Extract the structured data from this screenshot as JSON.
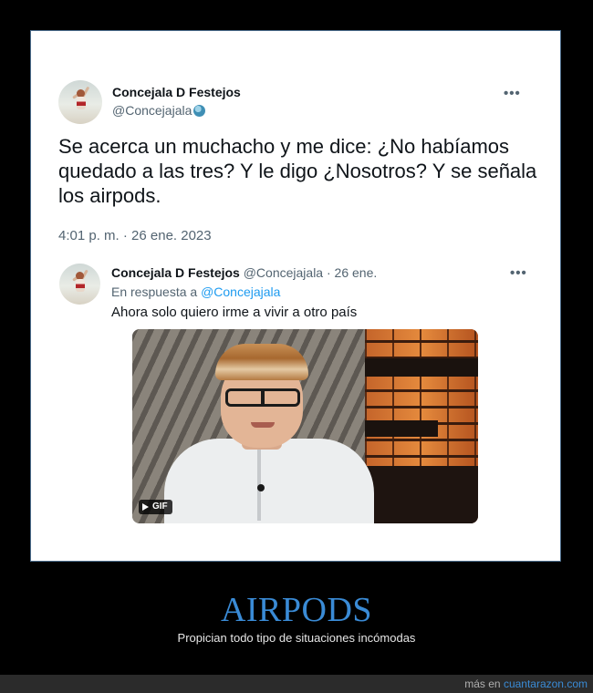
{
  "tweet": {
    "author_name": "Concejala D Festejos",
    "author_handle": "@Concejajala",
    "more_label": "•••",
    "text": "Se acerca un muchacho y me dice: ¿No habíamos quedado a las tres? Y le digo ¿Nosotros? Y se señala los airpods.",
    "timestamp": "4:01 p. m. · 26 ene. 2023"
  },
  "reply": {
    "author_name": "Concejala D Festejos",
    "author_handle": "@Concejajala",
    "separator": "·",
    "date": "26 ene.",
    "more_label": "•••",
    "replying_to_label": "En respuesta a",
    "replying_to_handle": "@Concejajala",
    "text": "Ahora solo quiero irme a vivir a otro país",
    "media_badge": "GIF"
  },
  "branding": {
    "title": "AIRPODS",
    "subtitle": "Propician todo tipo de situaciones incómodas",
    "footer_prefix": "más en",
    "footer_site": "cuantarazon.com"
  }
}
